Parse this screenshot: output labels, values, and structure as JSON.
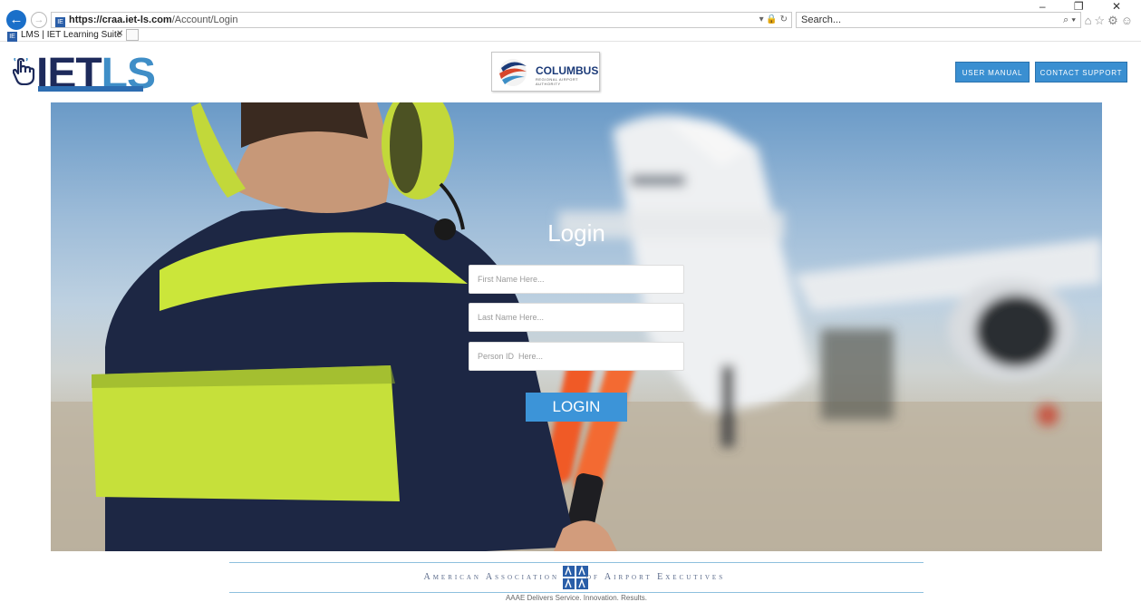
{
  "browser": {
    "url_host": "https://craa.iet-ls.com",
    "url_path": "/Account/Login",
    "search_placeholder": "Search...",
    "tab_title": "LMS | IET Learning Suite --A...",
    "window_controls": "–  ❐  ✕"
  },
  "header": {
    "logo_text_1": "IET",
    "logo_text_2": "LS",
    "partner_name": "COLUMBUS",
    "partner_sub": "REGIONAL AIRPORT AUTHORITY",
    "user_manual_label": "USER MANUAL",
    "contact_support_label": "CONTACT SUPPORT"
  },
  "login": {
    "title": "Login",
    "first_name_placeholder": "First Name Here...",
    "last_name_placeholder": "Last Name Here...",
    "person_id_placeholder": "Person ID  Here...",
    "button_label": "LOGIN"
  },
  "footer": {
    "org_left": "American Association",
    "org_right": "of Airport Executives",
    "tagline": "AAAE Delivers Service. Innovation. Results."
  },
  "colors": {
    "accent": "#3c94d8",
    "brand_dark": "#1d2a5b"
  }
}
